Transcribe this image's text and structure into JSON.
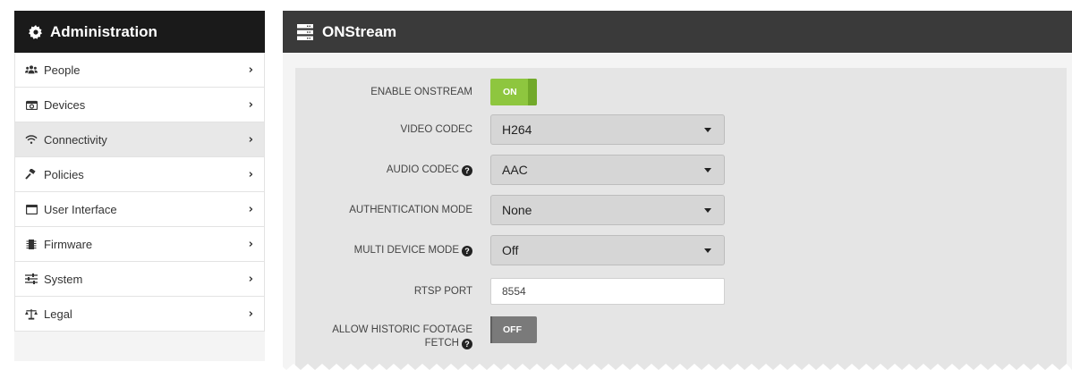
{
  "sidebar": {
    "title": "Administration",
    "title_icon": "gear-icon",
    "items": [
      {
        "label": "People",
        "icon": "people-icon",
        "active": false
      },
      {
        "label": "Devices",
        "icon": "camera-icon",
        "active": false
      },
      {
        "label": "Connectivity",
        "icon": "wifi-icon",
        "active": true
      },
      {
        "label": "Policies",
        "icon": "gavel-icon",
        "active": false
      },
      {
        "label": "User Interface",
        "icon": "window-icon",
        "active": false
      },
      {
        "label": "Firmware",
        "icon": "chip-icon",
        "active": false
      },
      {
        "label": "System",
        "icon": "sliders-icon",
        "active": false
      },
      {
        "label": "Legal",
        "icon": "scales-icon",
        "active": false
      }
    ]
  },
  "panel": {
    "title": "ONStream",
    "title_icon": "server-icon"
  },
  "form": {
    "enable_onstream": {
      "label": "ENABLE ONSTREAM",
      "value": "ON"
    },
    "video_codec": {
      "label": "VIDEO CODEC",
      "value": "H264"
    },
    "audio_codec": {
      "label": "AUDIO CODEC",
      "value": "AAC"
    },
    "auth_mode": {
      "label": "AUTHENTICATION MODE",
      "value": "None"
    },
    "multi_device_mode": {
      "label": "MULTI DEVICE MODE",
      "value": "Off"
    },
    "rtsp_port": {
      "label": "RTSP PORT",
      "value": "8554"
    },
    "allow_historic": {
      "label_line1": "ALLOW HISTORIC FOOTAGE",
      "label_line2": "FETCH",
      "value": "OFF"
    }
  },
  "colors": {
    "toggle_on": "#8ec63f",
    "toggle_off": "#7a7a7a",
    "sidebar_header": "#1a1a1a",
    "panel_header": "#3a3a3a"
  }
}
